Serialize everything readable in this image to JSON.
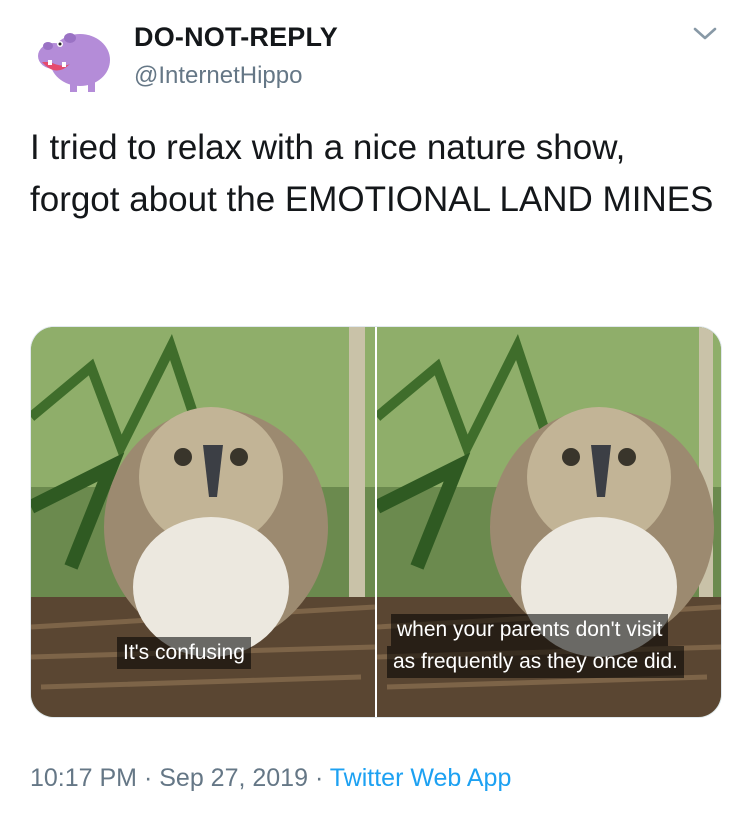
{
  "user": {
    "display_name": "DO-NOT-REPLY",
    "handle": "@InternetHippo"
  },
  "tweet": {
    "text": "I tried to relax with a nice nature show, forgot about the EMOTIONAL LAND MINES"
  },
  "media": {
    "left_caption": "It's confusing",
    "right_caption_line1": "when your parents don't visit",
    "right_caption_line2": "as frequently as they once did."
  },
  "meta": {
    "time": "10:17 PM",
    "date": "Sep 27, 2019",
    "separator": "·",
    "app": "Twitter Web App"
  },
  "colors": {
    "accent": "#1da1f2",
    "secondary_text": "#657786",
    "avatar_hippo": "#b48cd8"
  },
  "icons": {
    "avatar": "hippo-avatar-icon",
    "menu": "chevron-down-icon"
  }
}
